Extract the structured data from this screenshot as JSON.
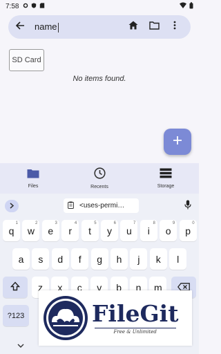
{
  "status_bar": {
    "time": "7:58",
    "icons": [
      "settings-icon",
      "shield-icon",
      "sd-card-icon",
      "wifi-icon",
      "battery-icon"
    ]
  },
  "search": {
    "query": "name",
    "back_icon": "arrow-left-icon",
    "home_icon": "home-icon",
    "folder_icon": "folder-icon",
    "menu_icon": "more-vert-icon"
  },
  "storage_chip": "SD Card",
  "empty_message": "No items found.",
  "fab_icon": "plus-icon",
  "bottom_nav": {
    "items": [
      {
        "label": "Files",
        "icon": "folder-icon"
      },
      {
        "label": "Recents",
        "icon": "clock-icon"
      },
      {
        "label": "Storage",
        "icon": "storage-icon"
      }
    ]
  },
  "keyboard": {
    "clipboard_suggestion": "<uses-permi…",
    "row1": [
      {
        "k": "q",
        "s": "1"
      },
      {
        "k": "w",
        "s": "2"
      },
      {
        "k": "e",
        "s": "3"
      },
      {
        "k": "r",
        "s": "4"
      },
      {
        "k": "t",
        "s": "5"
      },
      {
        "k": "y",
        "s": "6"
      },
      {
        "k": "u",
        "s": "7"
      },
      {
        "k": "i",
        "s": "8"
      },
      {
        "k": "o",
        "s": "9"
      },
      {
        "k": "p",
        "s": "0"
      }
    ],
    "row2": [
      "a",
      "s",
      "d",
      "f",
      "g",
      "h",
      "j",
      "k",
      "l"
    ],
    "row3": [
      "z",
      "x",
      "c",
      "v",
      "b",
      "n",
      "m"
    ],
    "sym_key": "?123"
  },
  "logo": {
    "name": "FileGit",
    "tagline": "Free & Unlimited"
  },
  "colors": {
    "search_bar": "#dde0f3",
    "fab": "#7c8ad6",
    "bottom_nav": "#e7e8f6",
    "logo_text": "#1e2a5e"
  }
}
